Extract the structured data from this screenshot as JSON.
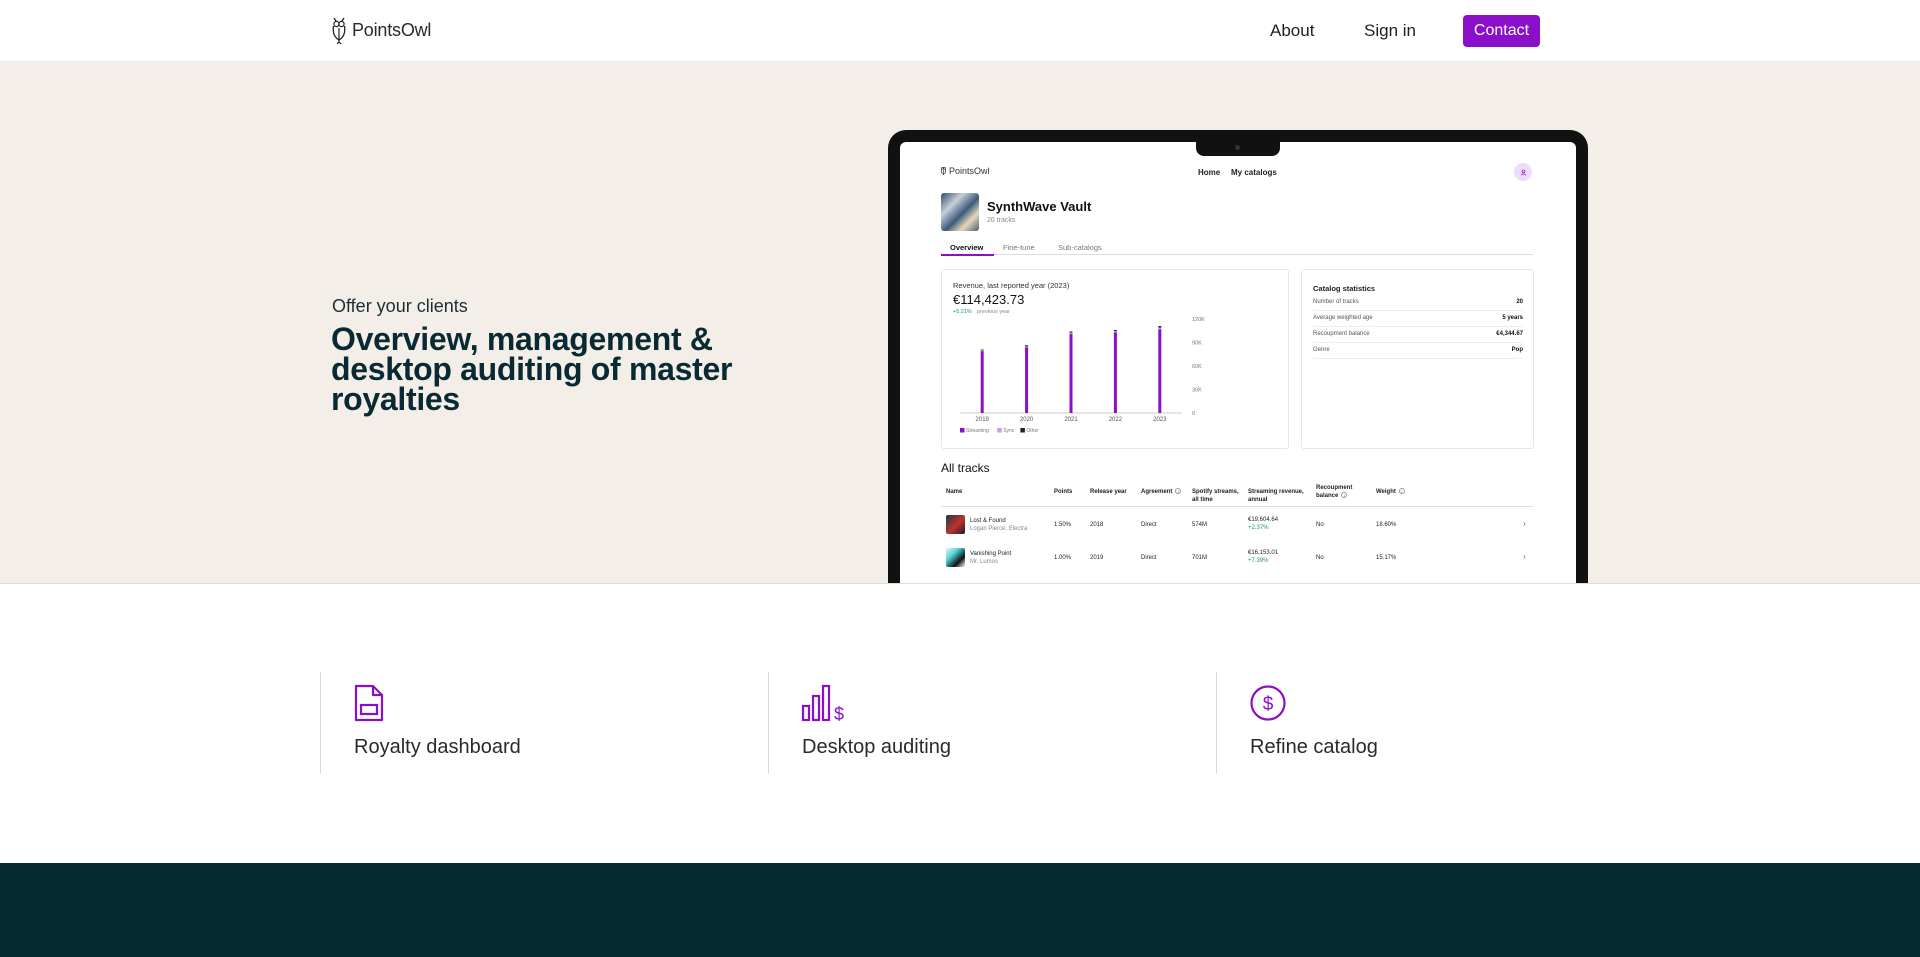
{
  "nav": {
    "brand": "PointsOwl",
    "about": "About",
    "signin": "Sign in",
    "contact": "Contact"
  },
  "hero": {
    "eyebrow": "Offer your clients",
    "title": "Overview, management & desktop auditing of master royalties"
  },
  "app": {
    "brand": "PointsOwl",
    "nav_home": "Home",
    "nav_catalogs": "My catalogs",
    "catalog_title": "SynthWave Vault",
    "catalog_subtitle": "20 tracks",
    "tabs": [
      "Overview",
      "Fine-tune",
      "Sub-catalogs"
    ],
    "revenue": {
      "label": "Revenue, last reported year (2023)",
      "value": "€114,423.73",
      "change": "+5.21%",
      "change_note": "previous year"
    },
    "stats": {
      "title": "Catalog statistics",
      "rows": [
        {
          "k": "Number of tracks",
          "v": "20"
        },
        {
          "k": "Average weighted age",
          "v": "5 years"
        },
        {
          "k": "Recoupment balance",
          "v": "€4,344.67"
        },
        {
          "k": "Genre",
          "v": "Pop"
        }
      ]
    },
    "tracks_title": "All tracks",
    "table": {
      "headers": [
        "Name",
        "Points",
        "Release year",
        "Agreement",
        "Spotify streams, all time",
        "Streaming revenue, annual",
        "Recoupment balance",
        "Weight"
      ],
      "rows": [
        {
          "name": "Lost & Found",
          "artist": "Logan Pierce, Electra",
          "points": "1.50%",
          "year": "2018",
          "agreement": "Direct",
          "streams": "574M",
          "revenue": "€19,604.64",
          "revenue_change": "+2.37%",
          "recoup": "No",
          "weight": "18.60%"
        },
        {
          "name": "Vanishing Point",
          "artist": "Mr. Lumos",
          "points": "1.00%",
          "year": "2019",
          "agreement": "Direct",
          "streams": "701M",
          "revenue": "€16,153.01",
          "revenue_change": "+7.39%",
          "recoup": "No",
          "weight": "15.17%"
        }
      ]
    }
  },
  "chart_data": {
    "type": "bar",
    "categories": [
      "2019",
      "2020",
      "2021",
      "2022",
      "2023"
    ],
    "series": [
      {
        "name": "Streaming",
        "values": [
          79000,
          84000,
          101000,
          103000,
          107000
        ],
        "color": "#8a0fc9"
      },
      {
        "name": "Sync",
        "values": [
          1000,
          1000,
          1500,
          1500,
          2000
        ],
        "color": "#c89be6"
      },
      {
        "name": "Other",
        "values": [
          1000,
          1500,
          1500,
          1500,
          2000
        ],
        "color": "#222222"
      }
    ],
    "y_ticks": [
      "0",
      "30K",
      "60K",
      "90K",
      "120K"
    ],
    "ylim": [
      0,
      120000
    ],
    "stacked": true,
    "legend": "bottom-left"
  },
  "features": [
    {
      "label": "Royalty dashboard",
      "icon": "document-icon"
    },
    {
      "label": "Desktop auditing",
      "icon": "bar-chart-dollar-icon"
    },
    {
      "label": "Refine catalog",
      "icon": "dollar-circle-icon"
    }
  ],
  "colors": {
    "accent": "#8a0fc9",
    "hero_bg": "#f3efe8",
    "heading": "#092a33",
    "footer_bg": "#052a31"
  }
}
